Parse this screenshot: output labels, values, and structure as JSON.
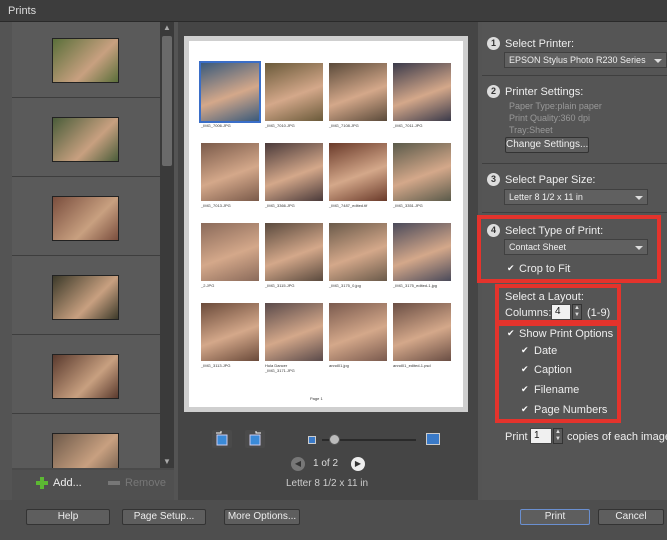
{
  "window": {
    "title": "Prints"
  },
  "left_panel": {
    "add_label": "Add...",
    "remove_label": "Remove",
    "thumbnails": [
      {
        "name": "photo-thumb-1",
        "color": "#5a6f3a"
      },
      {
        "name": "photo-thumb-2",
        "color": "#4a5d3a"
      },
      {
        "name": "photo-thumb-3",
        "color": "#7a4e3e"
      },
      {
        "name": "photo-thumb-4",
        "color": "#3c3a2a"
      },
      {
        "name": "photo-thumb-5",
        "color": "#5a3a2e"
      },
      {
        "name": "photo-thumb-6",
        "color": "#6e5a4a"
      }
    ]
  },
  "preview": {
    "page_counter": "1 of 2",
    "paper_size_caption": "Letter 8 1/2 x 11 in",
    "page_label": "Page 1",
    "contact_sheet": [
      {
        "label_line1": "",
        "label_line2": "_IMG_7006.JPG",
        "color": "#3a5a7a"
      },
      {
        "label_line1": "",
        "label_line2": "_IMG_7010.JPG",
        "color": "#6a5a3a"
      },
      {
        "label_line1": "",
        "label_line2": "_IMG_7108.JPG",
        "color": "#5a4a3a"
      },
      {
        "label_line1": "",
        "label_line2": "_IMG_7011.JPG",
        "color": "#3a3a4a"
      },
      {
        "label_line1": "",
        "label_line2": "_IMG_7013.JPG",
        "color": "#7a5a4a"
      },
      {
        "label_line1": "",
        "label_line2": "_IMG_3366.JPG",
        "color": "#4a3a3a"
      },
      {
        "label_line1": "",
        "label_line2": "_IMG_7487_edited.tif",
        "color": "#6a3a2a"
      },
      {
        "label_line1": "",
        "label_line2": "_IMG_3351.JPG",
        "color": "#5a5a4a"
      },
      {
        "label_line1": "",
        "label_line2": "_2.JPG",
        "color": "#8a6a5a"
      },
      {
        "label_line1": "",
        "label_line2": "_IMG_3115.JPG",
        "color": "#5a4a3e"
      },
      {
        "label_line1": "",
        "label_line2": "_IMG_3175_0.jpg",
        "color": "#6a5a4a"
      },
      {
        "label_line1": "",
        "label_line2": "_IMG_3175_edited-1.jpg",
        "color": "#4a4a5a"
      },
      {
        "label_line1": "",
        "label_line2": "_IMG_3113.JPG",
        "color": "#6a4a3a"
      },
      {
        "label_line1": "Hula Dancer",
        "label_line2": "_IMG_3171.JPG",
        "color": "#5a4a4a"
      },
      {
        "label_line1": "",
        "label_line2": "annd01.jpg",
        "color": "#7a5a4e"
      },
      {
        "label_line1": "",
        "label_line2": "annd01_edited-1.psd",
        "color": "#6a4e44"
      }
    ]
  },
  "steps": {
    "printer": {
      "number": "1",
      "title": "Select Printer:",
      "value": "EPSON Stylus Photo R230 Series"
    },
    "settings": {
      "number": "2",
      "title": "Printer Settings:",
      "paper_type": "Paper Type:plain paper",
      "quality": "Print Quality:360 dpi",
      "tray": "Tray:Sheet",
      "change_button": "Change Settings..."
    },
    "paper": {
      "number": "3",
      "title": "Select Paper Size:",
      "value": "Letter 8 1/2 x 11 in"
    },
    "print_type": {
      "number": "4",
      "title": "Select Type of Print:",
      "value": "Contact Sheet",
      "crop_to_fit": "Crop to Fit"
    },
    "layout": {
      "title": "Select a Layout:",
      "columns_label": "Columns:",
      "columns_value": "4",
      "columns_range": "(1-9)"
    },
    "options": {
      "show_print_options": "Show Print Options",
      "date": "Date",
      "caption": "Caption",
      "filename": "Filename",
      "page_numbers": "Page Numbers"
    },
    "copies": {
      "print_label": "Print",
      "value": "1",
      "suffix": "copies of each image"
    }
  },
  "footer": {
    "help": "Help",
    "page_setup": "Page Setup...",
    "more_options": "More Options...",
    "print": "Print",
    "cancel": "Cancel"
  },
  "colors": {
    "highlight_red": "#e4332c",
    "accent_blue": "#3a6ec8"
  }
}
